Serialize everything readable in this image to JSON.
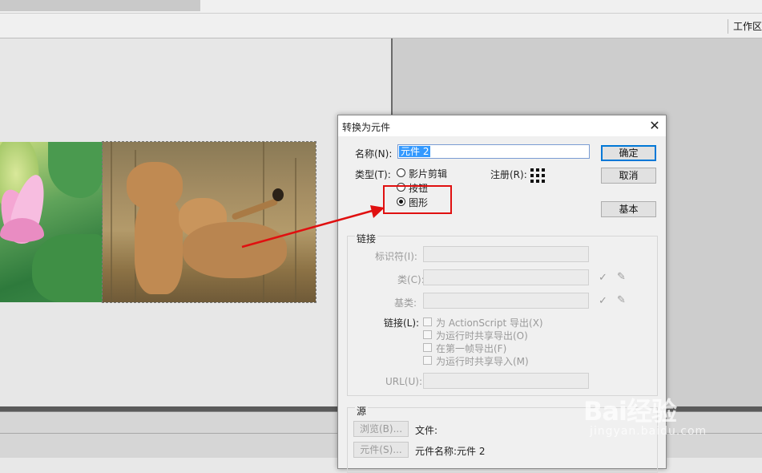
{
  "app": {
    "workspace_label": "工作区"
  },
  "dialog": {
    "title": "转换为元件",
    "name_label": "名称(N):",
    "name_value": "元件 2",
    "type_label": "类型(T):",
    "type_options": [
      "影片剪辑",
      "按钮",
      "图形"
    ],
    "selected_type": "图形",
    "registration_label": "注册(R):",
    "buttons": {
      "ok": "确定",
      "cancel": "取消",
      "basic": "基本"
    },
    "linkage_section": {
      "title": "链接",
      "identifier_label": "标识符(I):",
      "class_label": "类(C):",
      "base_class_label": "基类:",
      "linkage_label": "链接(L):",
      "checkboxes": [
        "为 ActionScript 导出(X)",
        "为运行时共享导出(O)",
        "在第一帧导出(F)",
        "为运行时共享导入(M)"
      ],
      "url_label": "URL(U):"
    },
    "source_section": {
      "title": "源",
      "browse_button": "浏览(B)...",
      "file_label": "文件:",
      "symbol_button": "元件(S)...",
      "symbol_name_label": "元件名称:元件 2"
    }
  },
  "watermark": {
    "brand": "Bai经验",
    "url": "jingyan.baidu.com"
  },
  "colors": {
    "annotation": "#e01010",
    "selection": "#3399ff"
  }
}
